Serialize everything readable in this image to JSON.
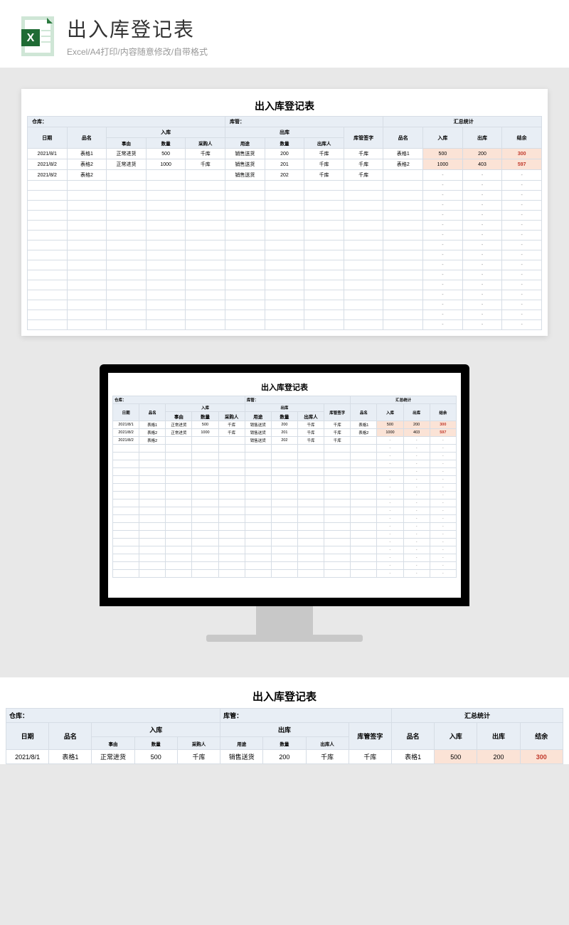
{
  "header": {
    "title": "出入库登记表",
    "subtitle": "Excel/A4打印/内容随意修改/自带格式"
  },
  "sheet": {
    "title": "出入库登记表",
    "meta": {
      "warehouse_label": "仓库：",
      "keeper_label": "库管：",
      "summary_label": "汇总统计"
    },
    "head1": {
      "date": "日期",
      "item": "品名",
      "in": "入库",
      "out": "出库",
      "sign": "库管签字",
      "s_item": "品名",
      "s_in": "入库",
      "s_out": "出库",
      "s_bal": "结余"
    },
    "head2": {
      "reason": "事由",
      "qty": "数量",
      "buyer": "采购人",
      "use": "用途",
      "qty2": "数量",
      "outp": "出库人"
    },
    "rows": [
      {
        "date": "2021/8/1",
        "item": "表格1",
        "reason": "正常进货",
        "in_qty": "500",
        "buyer": "千库",
        "use": "销售送货",
        "out_qty": "200",
        "outp": "千库",
        "sign": "千库",
        "s_item": "表格1",
        "s_in": "500",
        "s_out": "200",
        "s_bal": "300"
      },
      {
        "date": "2021/8/2",
        "item": "表格2",
        "reason": "正常进货",
        "in_qty": "1000",
        "buyer": "千库",
        "use": "销售送货",
        "out_qty": "201",
        "outp": "千库",
        "sign": "千库",
        "s_item": "表格2",
        "s_in": "1000",
        "s_out": "403",
        "s_bal": "597"
      },
      {
        "date": "2021/8/2",
        "item": "表格2",
        "reason": "",
        "in_qty": "",
        "buyer": "",
        "use": "销售送货",
        "out_qty": "202",
        "outp": "千库",
        "sign": "千库",
        "s_item": "",
        "s_in": "-",
        "s_out": "-",
        "s_bal": "-"
      }
    ],
    "empty_rows": 15
  }
}
